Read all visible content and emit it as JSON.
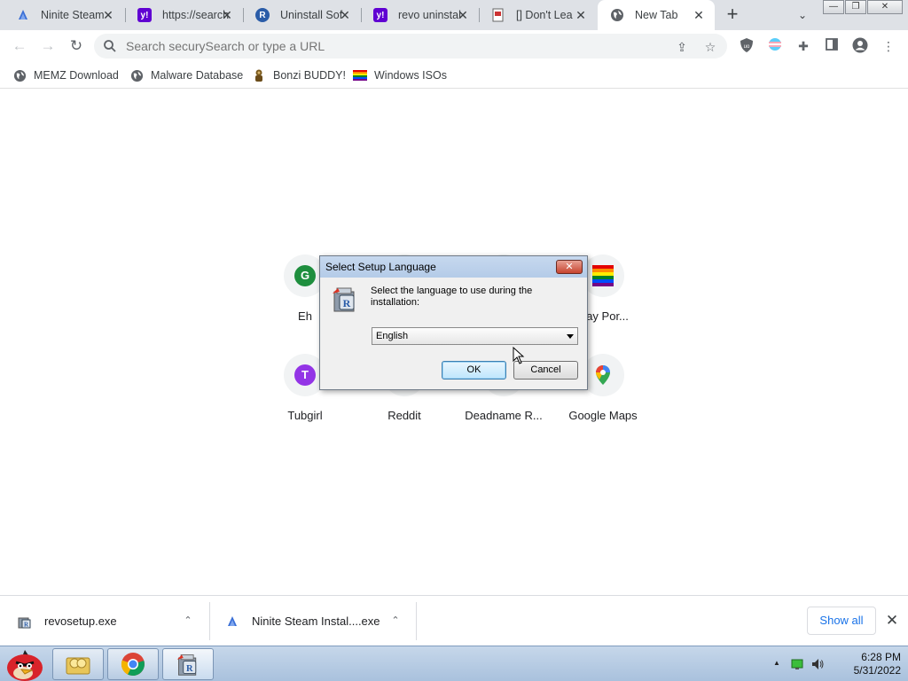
{
  "browser": {
    "tabs": [
      {
        "title": "Ninite Steam",
        "favicon": "ninite-icon"
      },
      {
        "title": "https://search",
        "favicon": "yahoo-icon"
      },
      {
        "title": "Uninstall Sof",
        "favicon": "revo-icon"
      },
      {
        "title": "revo uninstal",
        "favicon": "yahoo-icon"
      },
      {
        "title": "[] Don't Lea",
        "favicon": "page-icon"
      },
      {
        "title": "New Tab",
        "favicon": "globe-icon"
      }
    ],
    "close_glyph": "✕",
    "newtab_glyph": "+",
    "omnibox_placeholder": "Search securySearch or type a URL"
  },
  "bookmarks": [
    {
      "label": "MEMZ Download",
      "icon": "globe-icon"
    },
    {
      "label": "Malware Database",
      "icon": "globe-icon"
    },
    {
      "label": "Bonzi BUDDY!",
      "icon": "bonzi-icon"
    },
    {
      "label": "Windows ISOs",
      "icon": "rainbow-flag-icon"
    }
  ],
  "shortcuts": [
    {
      "label": "Eh",
      "letter": "G",
      "color": "#1e8e3e"
    },
    {
      "label": "Gay Por...",
      "letter": "",
      "color": ""
    },
    {
      "label": "Tubgirl",
      "letter": "T",
      "color": "#9334e6"
    },
    {
      "label": "Reddit",
      "letter": "",
      "color": ""
    },
    {
      "label": "Deadname R...",
      "letter": "",
      "color": ""
    },
    {
      "label": "Google Maps",
      "letter": "",
      "color": ""
    }
  ],
  "dialog": {
    "title": "Select Setup Language",
    "message": "Select the language to use during the installation:",
    "selected_language": "English",
    "ok_label": "OK",
    "cancel_label": "Cancel"
  },
  "downloads": {
    "items": [
      {
        "filename": "revosetup.exe",
        "icon": "revo-setup-icon"
      },
      {
        "filename": "Ninite Steam Instal....exe",
        "icon": "ninite-icon"
      }
    ],
    "show_all_label": "Show all"
  },
  "taskbar": {
    "time": "6:28 PM",
    "date": "5/31/2022"
  }
}
